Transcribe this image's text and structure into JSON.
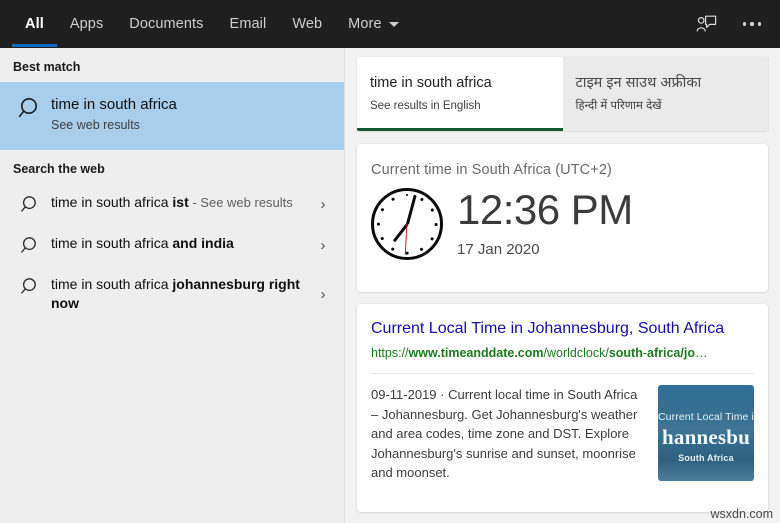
{
  "topnav": {
    "items": [
      {
        "label": "All",
        "active": true
      },
      {
        "label": "Apps",
        "active": false
      },
      {
        "label": "Documents",
        "active": false
      },
      {
        "label": "Email",
        "active": false
      },
      {
        "label": "Web",
        "active": false
      },
      {
        "label": "More",
        "active": false,
        "caret": true
      }
    ],
    "feedback_icon": "person-feedback-icon",
    "overflow_icon": "ellipsis-icon",
    "active_underline_color": "#0d6cc4",
    "background_color": "#1f1f1f"
  },
  "left_panel": {
    "best_match": {
      "section_label": "Best match",
      "icon": "search-icon",
      "title": "time in south africa",
      "subtitle": "See web results",
      "highlight_color": "#a9ceeb"
    },
    "search_the_web": {
      "section_label": "Search the web",
      "items": [
        {
          "icon": "search-icon",
          "prefix": "time in south africa ",
          "bold": "ist",
          "suffix": " - See web results",
          "chevron": "chevron-right-icon"
        },
        {
          "icon": "search-icon",
          "prefix": "time in south africa ",
          "bold": "and india",
          "suffix": "",
          "chevron": "chevron-right-icon"
        },
        {
          "icon": "search-icon",
          "prefix": "time in south africa ",
          "bold": "johannesburg right now",
          "suffix": "",
          "chevron": "chevron-right-icon"
        }
      ]
    }
  },
  "right_panel": {
    "language_tabs": [
      {
        "title": "time in south africa",
        "subtitle": "See results in English",
        "active": true,
        "underline_color": "#13562f"
      },
      {
        "title": "टाइम इन साउथ अफ्रीका",
        "subtitle": "हिन्दी में परिणाम देखें",
        "active": false,
        "underline_color": ""
      }
    ],
    "clock_card": {
      "heading": "Current time in South Africa (UTC+2)",
      "time": "12:36 PM",
      "date": "17 Jan 2020",
      "clock_icon": "analog-clock-icon",
      "hour_angle": 378,
      "minute_angle": 216,
      "second_angle": 180
    },
    "web_result": {
      "title": "Current Local Time in Johannesburg, South Africa",
      "url_parts": [
        {
          "text": "https://",
          "bold": false
        },
        {
          "text": "www.timeanddate.com",
          "bold": true
        },
        {
          "text": "/worldclock/",
          "bold": false
        },
        {
          "text": "south",
          "bold": true
        },
        {
          "text": "-",
          "bold": false
        },
        {
          "text": "africa/jo",
          "bold": true
        },
        {
          "text": "…",
          "bold": false
        }
      ],
      "snippet": "09-11-2019 · Current local time in South Africa – Johannesburg. Get Johannesburg's weather and area codes, time zone and DST. Explore Johannesburg's sunrise and sunset, moonrise and moonset.",
      "thumbnail": {
        "line1": "Current Local Time in",
        "line2": "hannesbu",
        "line3": "South Africa"
      }
    }
  },
  "watermark": "wsxdn.com"
}
